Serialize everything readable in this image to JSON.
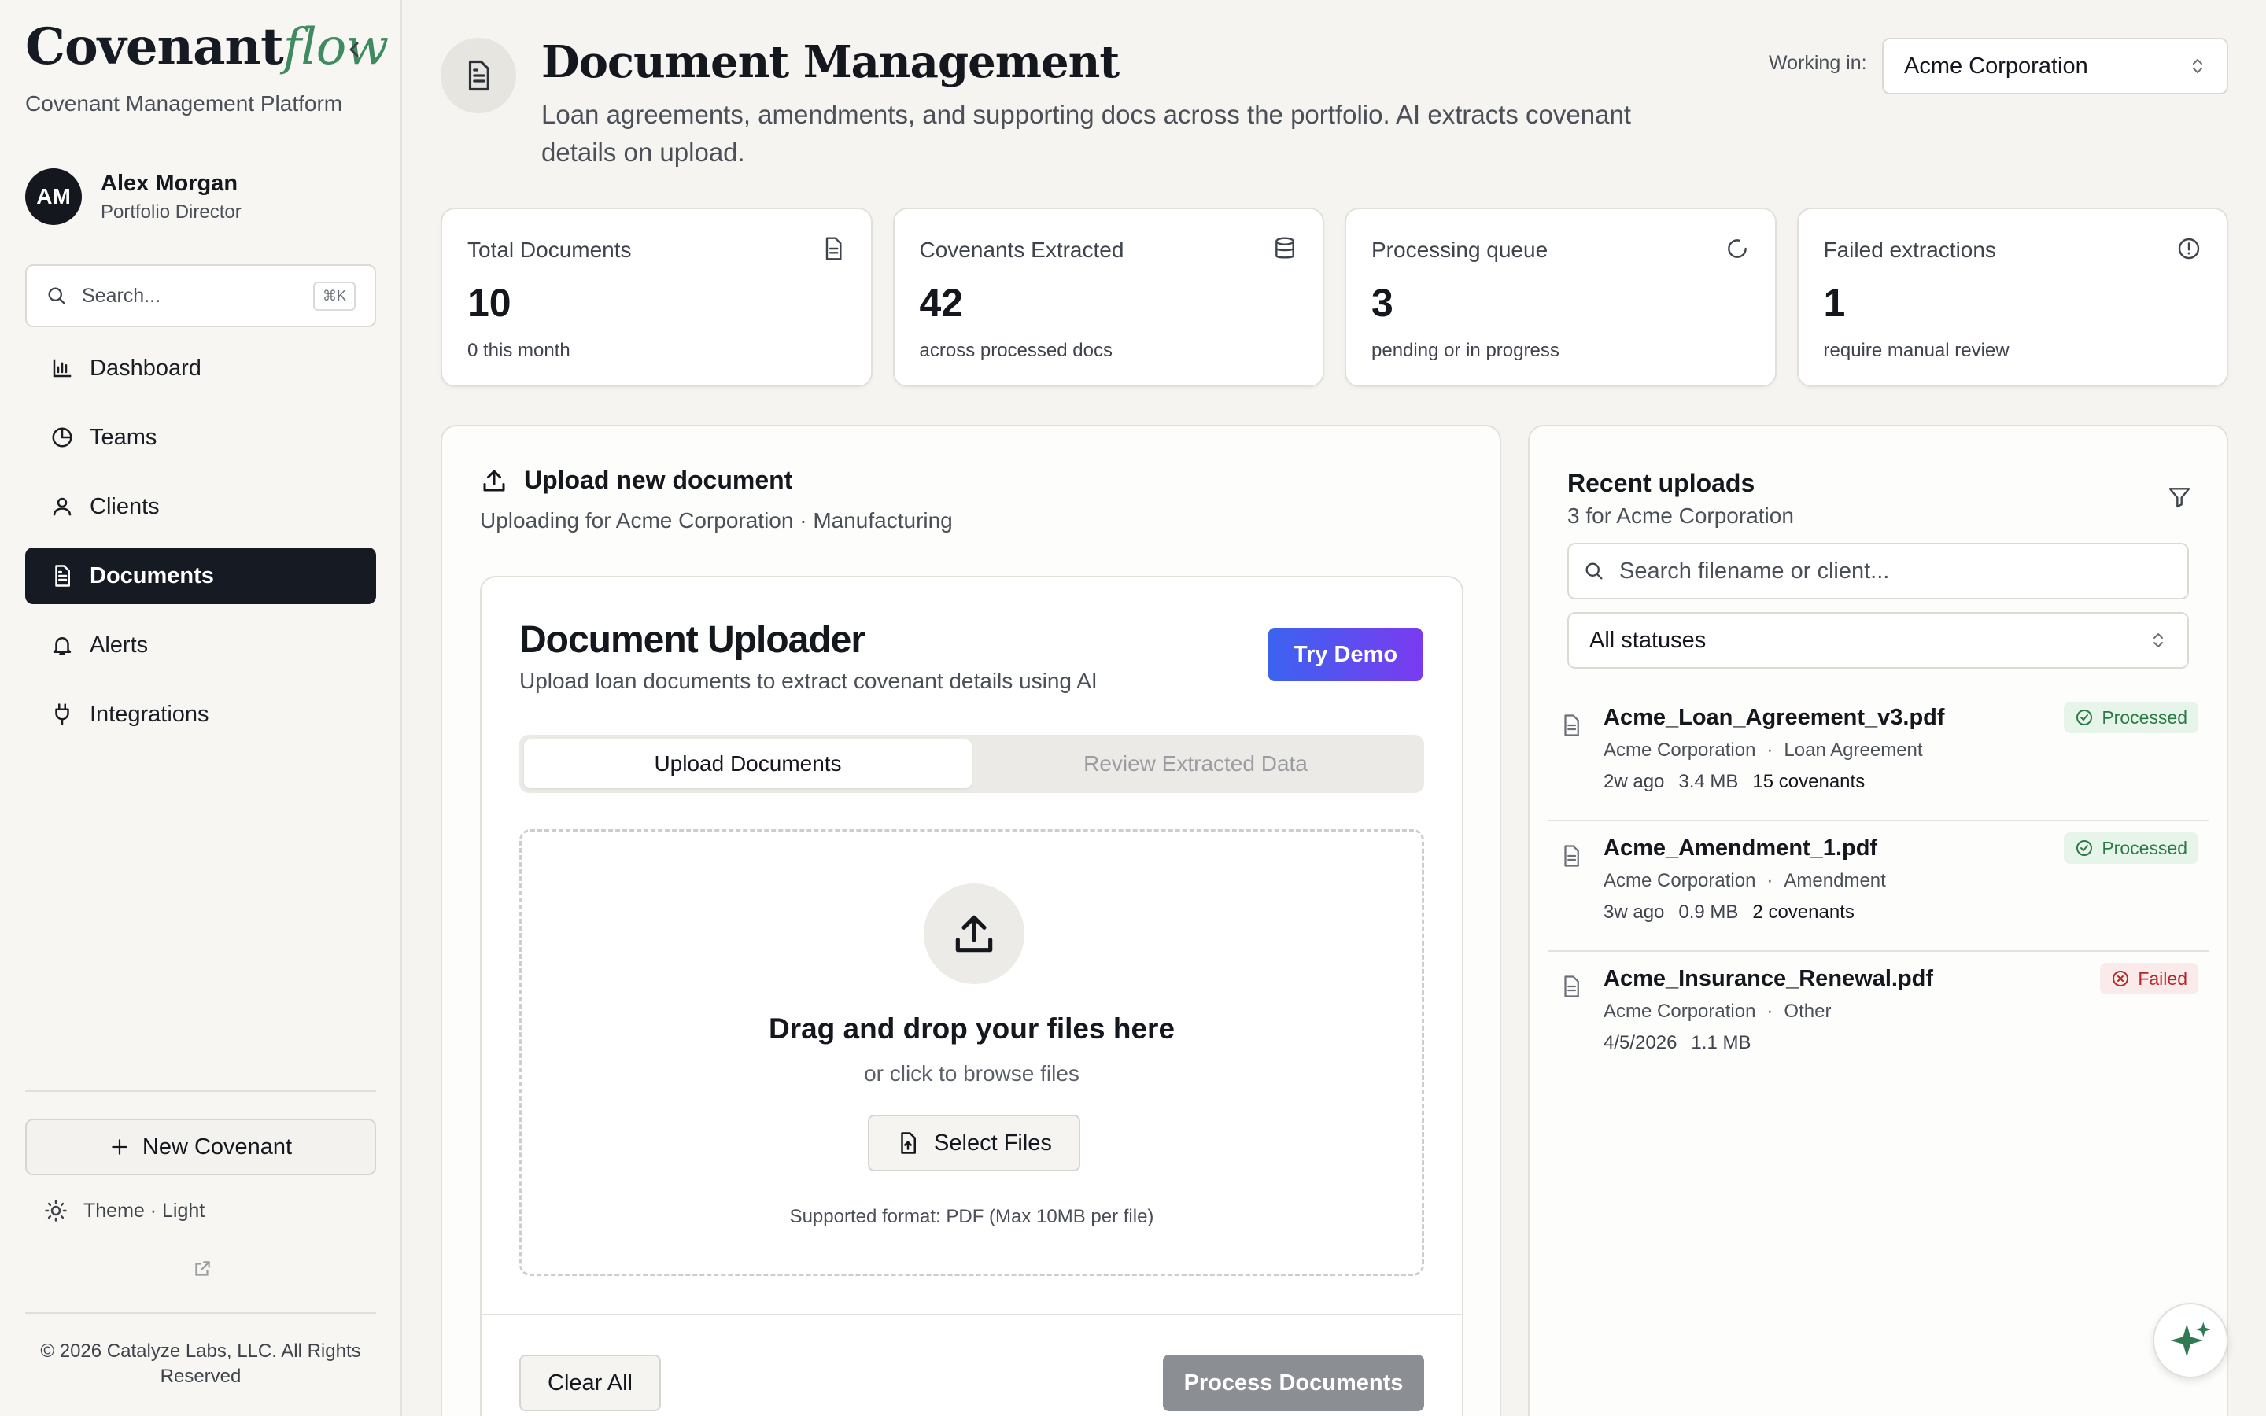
{
  "brand": {
    "part1": "Covenant",
    "part2": "flow",
    "tagline": "Covenant Management Platform"
  },
  "user": {
    "initials": "AM",
    "name": "Alex Morgan",
    "role": "Portfolio Director"
  },
  "sidebar_search": {
    "placeholder": "Search...",
    "shortcut": "⌘K"
  },
  "nav": [
    {
      "label": "Dashboard",
      "icon": "bar-chart-icon"
    },
    {
      "label": "Teams",
      "icon": "pie-chart-icon"
    },
    {
      "label": "Clients",
      "icon": "user-icon"
    },
    {
      "label": "Documents",
      "icon": "document-icon",
      "active": true
    },
    {
      "label": "Alerts",
      "icon": "bell-icon"
    },
    {
      "label": "Integrations",
      "icon": "plug-icon"
    }
  ],
  "new_covenant_label": "New Covenant",
  "theme_label": "Theme · Light",
  "copyright": "© 2026 Catalyze Labs, LLC. All Rights Reserved",
  "header": {
    "title": "Document Management",
    "subtitle": "Loan agreements, amendments, and supporting docs across the portfolio. AI extracts covenant details on upload.",
    "working_label": "Working in:",
    "working_value": "Acme Corporation"
  },
  "stats": [
    {
      "label": "Total Documents",
      "value": "10",
      "desc": "0 this month",
      "icon": "document-icon"
    },
    {
      "label": "Covenants Extracted",
      "value": "42",
      "desc": "across processed docs",
      "icon": "database-icon"
    },
    {
      "label": "Processing queue",
      "value": "3",
      "desc": "pending or in progress",
      "icon": "refresh-icon"
    },
    {
      "label": "Failed extractions",
      "value": "1",
      "desc": "require manual review",
      "icon": "alert-circle-icon"
    }
  ],
  "upload": {
    "heading": "Upload new document",
    "context": "Uploading for Acme Corporation · Manufacturing",
    "uploader_title": "Document Uploader",
    "uploader_sub": "Upload loan documents to extract covenant details using AI",
    "try_demo": "Try Demo",
    "tabs": [
      "Upload Documents",
      "Review Extracted Data"
    ],
    "drop_title": "Drag and drop your files here",
    "drop_sub": "or click to browse files",
    "select_files": "Select Files",
    "supported": "Supported format: PDF (Max 10MB per file)",
    "clear_all": "Clear All",
    "process": "Process Documents"
  },
  "recent": {
    "title": "Recent uploads",
    "subtitle": "3 for Acme Corporation",
    "search_placeholder": "Search filename or client...",
    "status_filter": "All statuses",
    "files": [
      {
        "name": "Acme_Loan_Agreement_v3.pdf",
        "client": "Acme Corporation",
        "type": "Loan Agreement",
        "age": "2w ago",
        "size": "3.4 MB",
        "covenants": "15 covenants",
        "status": "Processed"
      },
      {
        "name": "Acme_Amendment_1.pdf",
        "client": "Acme Corporation",
        "type": "Amendment",
        "age": "3w ago",
        "size": "0.9 MB",
        "covenants": "2 covenants",
        "status": "Processed"
      },
      {
        "name": "Acme_Insurance_Renewal.pdf",
        "client": "Acme Corporation",
        "type": "Other",
        "age": "4/5/2026",
        "size": "1.1 MB",
        "covenants": "",
        "status": "Failed"
      }
    ]
  },
  "colors": {
    "brand_green": "#3f8a5f",
    "nav_active": "#161a22",
    "success": "#2b7a45",
    "danger": "#b42828",
    "demo_start": "#3b63f0",
    "demo_end": "#7a3bf0"
  }
}
